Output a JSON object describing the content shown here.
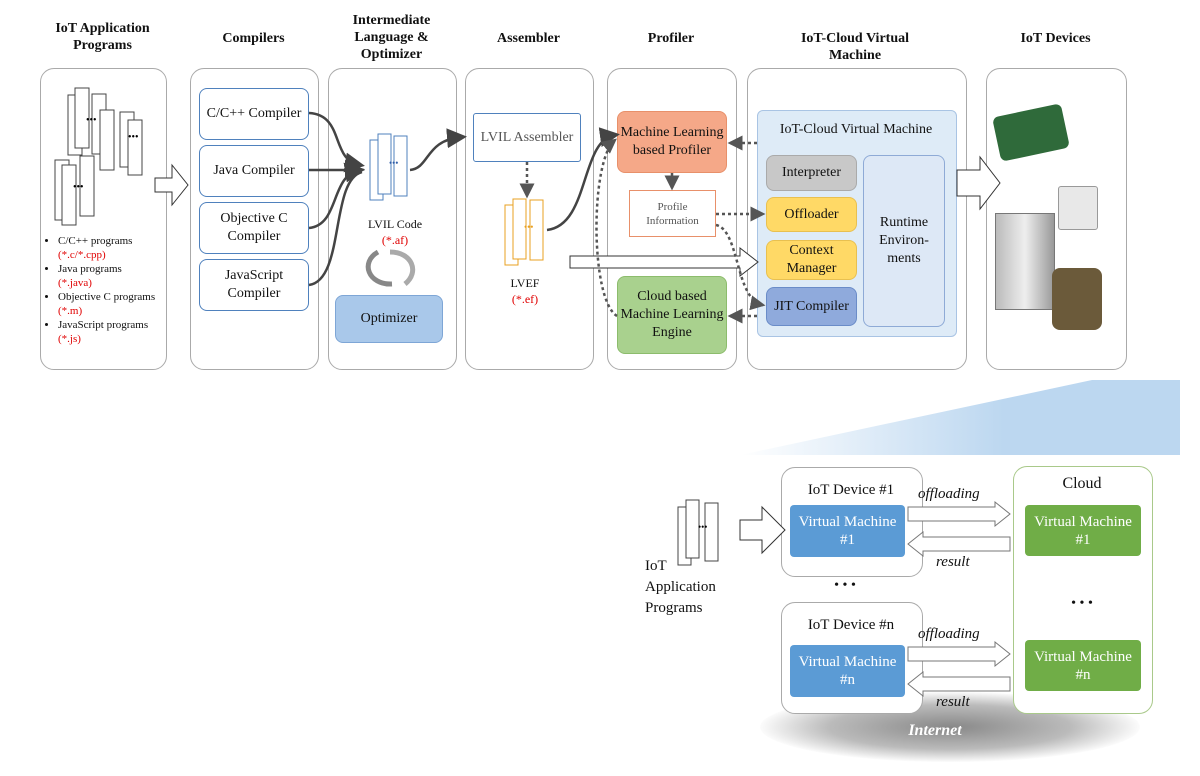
{
  "headers": {
    "apps": "IoT Application Programs",
    "compilers": "Compilers",
    "il": "Intermediate Language & Optimizer",
    "assembler": "Assembler",
    "profiler": "Profiler",
    "vm": "IoT-Cloud Virtual Machine",
    "devices": "IoT Devices"
  },
  "programs": [
    {
      "name": "C/C++ programs",
      "ext": "(*.c/*.cpp)"
    },
    {
      "name": "Java programs",
      "ext": "(*.java)"
    },
    {
      "name": "Objective C programs",
      "ext": "(*.m)"
    },
    {
      "name": "JavaScript programs",
      "ext": "(*.js)"
    }
  ],
  "compilers": [
    "C/C++ Compiler",
    "Java Compiler",
    "Objective C Compiler",
    "JavaScript Compiler"
  ],
  "lvil": {
    "label": "LVIL Code",
    "ext": "(*.af)",
    "optimizer": "Optimizer"
  },
  "assembler": {
    "box": "LVIL Assembler",
    "label": "LVEF",
    "ext": "(*.ef)"
  },
  "profiler": {
    "ml": "Machine Learning based Profiler",
    "info": "Profile Information",
    "cloud": "Cloud based Machine Learning Engine"
  },
  "vm": {
    "title": "IoT-Cloud Virtual  Machine",
    "interpreter": "Interpreter",
    "offloader": "Offloader",
    "context": "Context Manager",
    "jit": "JIT Compiler",
    "runtime": "Runtime Environ-ments"
  },
  "bottom": {
    "apps": "IoT Application Programs",
    "device1": "IoT Device #1",
    "devicen": "IoT Device #n",
    "vm1": "Virtual Machine #1",
    "vmn": "Virtual Machine #n",
    "cloud": "Cloud",
    "offloading": "offloading",
    "result": "result",
    "ellipsis": "• • •",
    "internet": "Internet"
  },
  "colors": {
    "ml": "#f5a888",
    "cloud_engine": "#a9d18e",
    "interpreter": "#c8c8c8",
    "offloader": "#ffd966",
    "jit": "#8faadc",
    "vm_bg": "#deebf7",
    "device_vm": "#5b9bd5",
    "cloud_vm": "#70ad47"
  }
}
